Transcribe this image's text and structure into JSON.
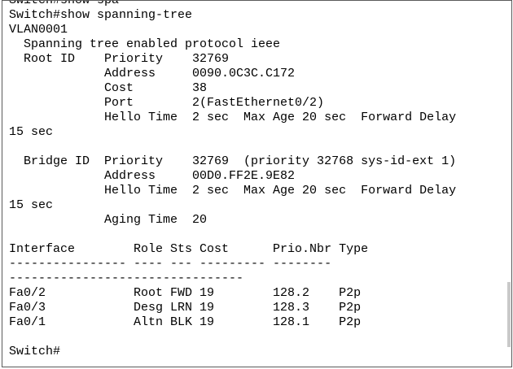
{
  "terminal": {
    "lines": [
      "Switch#show spa",
      "Switch#show spanning-tree",
      "VLAN0001",
      "  Spanning tree enabled protocol ieee",
      "  Root ID    Priority    32769",
      "             Address     0090.0C3C.C172",
      "             Cost        38",
      "             Port        2(FastEthernet0/2)",
      "             Hello Time  2 sec  Max Age 20 sec  Forward Delay",
      "15 sec",
      "",
      "  Bridge ID  Priority    32769  (priority 32768 sys-id-ext 1)",
      "             Address     00D0.FF2E.9E82",
      "             Hello Time  2 sec  Max Age 20 sec  Forward Delay",
      "15 sec",
      "             Aging Time  20",
      "",
      "Interface        Role Sts Cost      Prio.Nbr Type",
      "---------------- ---- --- --------- --------",
      "--------------------------------",
      "Fa0/2            Root FWD 19        128.2    P2p",
      "Fa0/3            Desg LRN 19        128.3    P2p",
      "Fa0/1            Altn BLK 19        128.1    P2p",
      "",
      "Switch#"
    ]
  }
}
